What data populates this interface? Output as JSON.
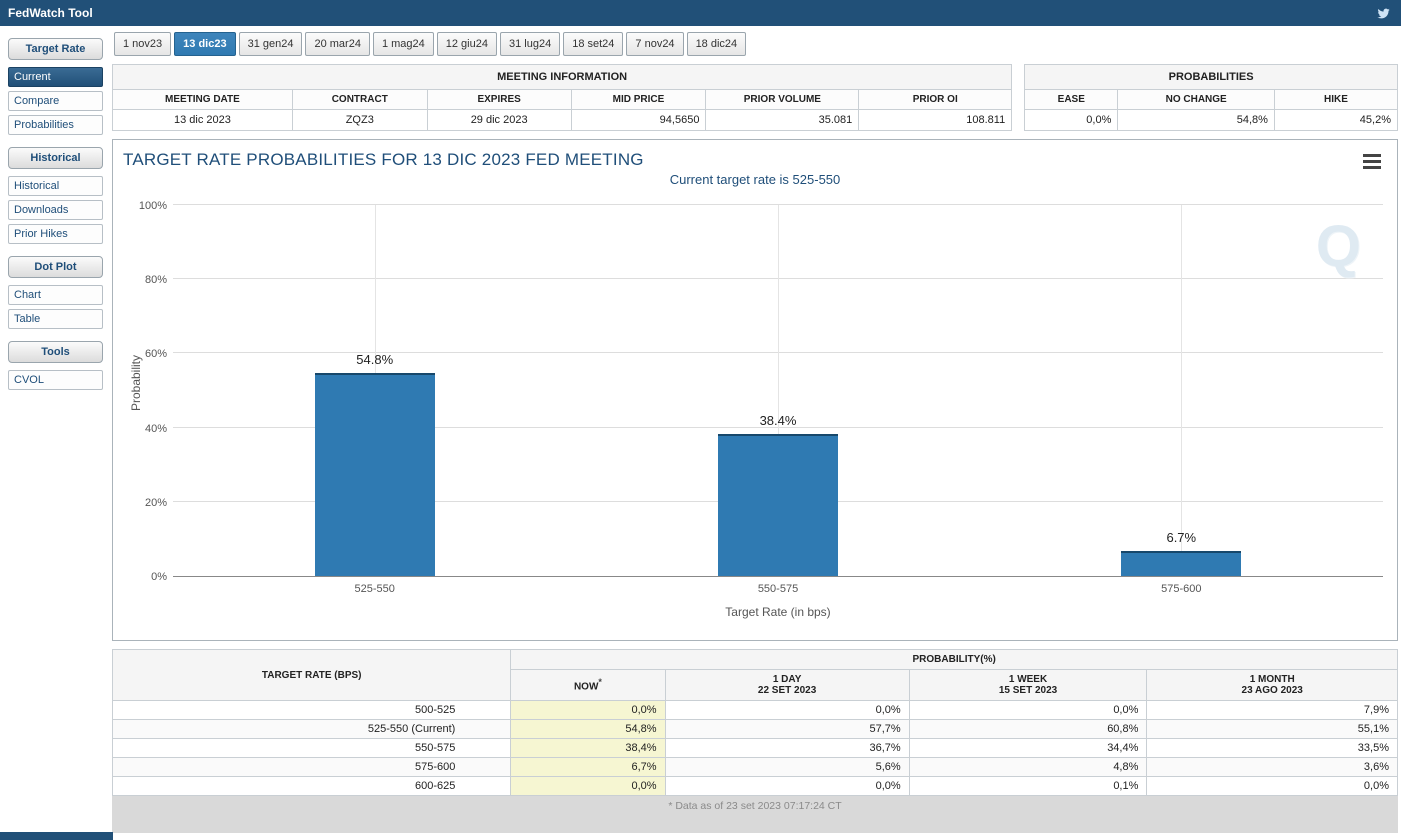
{
  "app": {
    "title": "FedWatch Tool",
    "header_color": "#215078",
    "accent_color": "#2f7ab2"
  },
  "tabs": {
    "active_index": 1,
    "items": [
      "1 nov23",
      "13 dic23",
      "31 gen24",
      "20 mar24",
      "1 mag24",
      "12 giu24",
      "31 lug24",
      "18 set24",
      "7 nov24",
      "18 dic24"
    ]
  },
  "sidebar": {
    "sections": [
      {
        "header": "Target Rate",
        "items": [
          {
            "label": "Current",
            "active": true
          },
          {
            "label": "Compare",
            "active": false
          },
          {
            "label": "Probabilities",
            "active": false
          }
        ]
      },
      {
        "header": "Historical",
        "items": [
          {
            "label": "Historical",
            "active": false
          },
          {
            "label": "Downloads",
            "active": false
          },
          {
            "label": "Prior Hikes",
            "active": false
          }
        ]
      },
      {
        "header": "Dot Plot",
        "items": [
          {
            "label": "Chart",
            "active": false
          },
          {
            "label": "Table",
            "active": false
          }
        ]
      },
      {
        "header": "Tools",
        "items": [
          {
            "label": "CVOL",
            "active": false
          }
        ]
      }
    ]
  },
  "meeting_info": {
    "title": "MEETING INFORMATION",
    "headers": [
      "MEETING DATE",
      "CONTRACT",
      "EXPIRES",
      "MID PRICE",
      "PRIOR VOLUME",
      "PRIOR OI"
    ],
    "values": [
      "13 dic 2023",
      "ZQZ3",
      "29 dic 2023",
      "94,5650",
      "35.081",
      "108.811"
    ]
  },
  "probabilities_panel": {
    "title": "PROBABILITIES",
    "headers": [
      "EASE",
      "NO CHANGE",
      "HIKE"
    ],
    "values": [
      "0,0%",
      "54,8%",
      "45,2%"
    ]
  },
  "chart_data": {
    "type": "bar",
    "title": "TARGET RATE PROBABILITIES FOR 13 DIC 2023 FED MEETING",
    "subtitle": "Current target rate is 525-550",
    "categories": [
      "525-550",
      "550-575",
      "575-600"
    ],
    "values": [
      54.8,
      38.4,
      6.7
    ],
    "bar_labels": [
      "54.8%",
      "38.4%",
      "6.7%"
    ],
    "xlabel": "Target Rate (in bps)",
    "ylabel": "Probability",
    "ylim": [
      0,
      100
    ],
    "yticks": [
      "0%",
      "20%",
      "40%",
      "60%",
      "80%",
      "100%"
    ],
    "grid": true,
    "legend": "none",
    "bar_color": "#2f7ab2",
    "watermark": "Q"
  },
  "prob_table": {
    "rate_header": "TARGET RATE (BPS)",
    "group_header": "PROBABILITY(%)",
    "columns": [
      {
        "label": "NOW",
        "sub": "",
        "star": "*"
      },
      {
        "label": "1 DAY",
        "sub": "22 SET 2023",
        "star": ""
      },
      {
        "label": "1 WEEK",
        "sub": "15 SET 2023",
        "star": ""
      },
      {
        "label": "1 MONTH",
        "sub": "23 AGO 2023",
        "star": ""
      }
    ],
    "rows": [
      {
        "rate": "500-525",
        "values": [
          "0,0%",
          "0,0%",
          "0,0%",
          "7,9%"
        ]
      },
      {
        "rate": "525-550 (Current)",
        "values": [
          "54,8%",
          "57,7%",
          "60,8%",
          "55,1%"
        ]
      },
      {
        "rate": "550-575",
        "values": [
          "38,4%",
          "36,7%",
          "34,4%",
          "33,5%"
        ]
      },
      {
        "rate": "575-600",
        "values": [
          "6,7%",
          "5,6%",
          "4,8%",
          "3,6%"
        ]
      },
      {
        "rate": "600-625",
        "values": [
          "0,0%",
          "0,0%",
          "0,1%",
          "0,0%"
        ]
      }
    ]
  },
  "footer": {
    "note": "* Data as of 23 set 2023 07:17:24 CT"
  }
}
